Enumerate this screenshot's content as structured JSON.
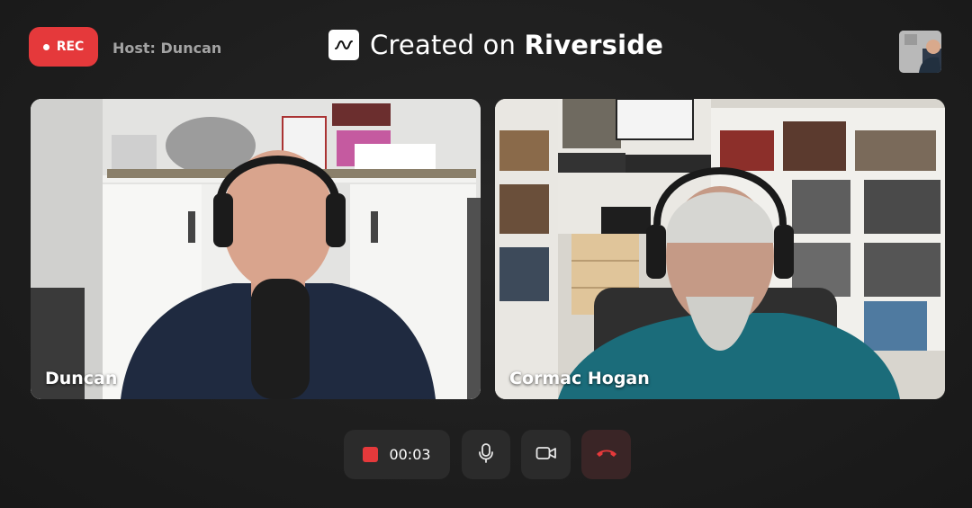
{
  "header": {
    "rec_label": "REC",
    "host_label": "Host: Duncan",
    "brand_prefix": "Created on ",
    "brand_name": "Riverside"
  },
  "participants": [
    {
      "name": "Duncan"
    },
    {
      "name": "Cormac Hogan"
    }
  ],
  "controls": {
    "timer": "00:03",
    "icons": [
      "stop-recording-icon",
      "microphone-icon",
      "camera-icon",
      "end-call-icon"
    ]
  },
  "colors": {
    "rec_red": "#e5393b",
    "end_call_red": "#e5393b",
    "background": "#1e1e1e",
    "control_bg": "#2b2b2b"
  }
}
